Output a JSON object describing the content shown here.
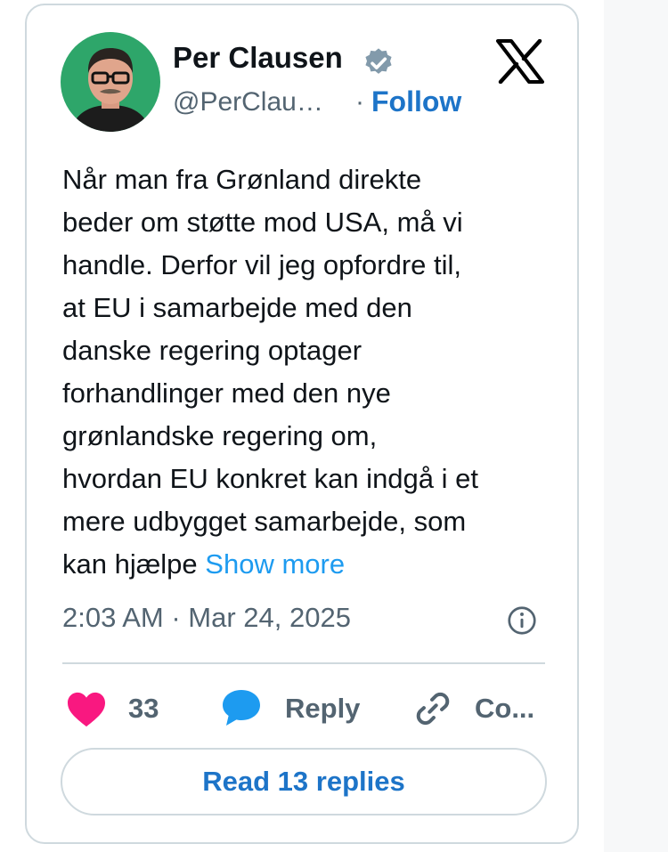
{
  "tweet": {
    "author": {
      "name": "Per Clausen",
      "handle": "@PerClau…",
      "verified": true,
      "avatar_bg": "#2ea66a"
    },
    "follow_label": "Follow",
    "separator": "·",
    "text_lines": [
      "Når man fra Grønland direkte",
      "beder om støtte mod USA, må vi",
      "handle. Derfor vil jeg opfordre til,",
      "at EU i samarbejde med den",
      "danske regering optager",
      "forhandlinger med den nye",
      "grønlandske regering om,",
      "hvordan EU konkret kan indgå i et",
      "mere udbygget samarbejde, som",
      "kan hjælpe "
    ],
    "show_more_label": "Show more",
    "timestamp": "2:03 AM · Mar 24, 2025",
    "actions": {
      "like_count": "33",
      "reply_label": "Reply",
      "copy_label": "Co..."
    },
    "read_replies_label": "Read 13 replies"
  },
  "colors": {
    "like": "#f91880",
    "reply": "#1d9bf0",
    "link": "#1d74c8",
    "muted": "#536471",
    "border": "#cfd9de"
  },
  "icons": [
    "verified-badge-icon",
    "x-logo-icon",
    "info-icon",
    "heart-icon",
    "reply-bubble-icon",
    "link-icon"
  ]
}
